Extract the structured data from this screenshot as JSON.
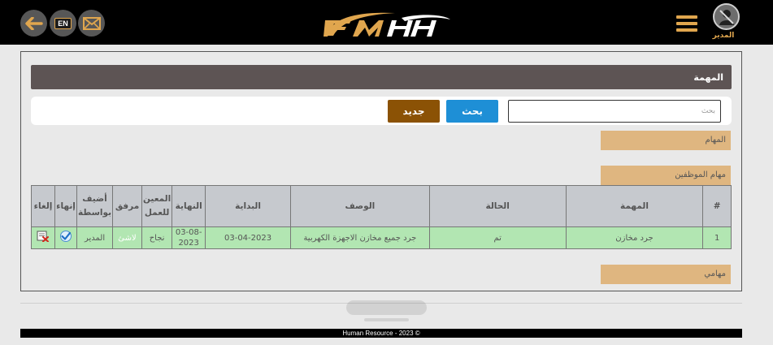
{
  "header": {
    "lang_label": "EN",
    "user_name": "المدير",
    "brand_accent": "#e0a64e",
    "icons": [
      "arrow-left-icon",
      "language-icon",
      "mail-icon",
      "hamburger-menu-icon",
      "user-avatar-icon"
    ]
  },
  "page": {
    "title": "المهمة",
    "search_placeholder": "بحث",
    "search_button": "بحث",
    "new_button": "جديد",
    "sections": {
      "tasks": "المهام",
      "employee_tasks": "مهام الموظفين",
      "my_tasks": "مهامي"
    }
  },
  "table": {
    "headers": {
      "index": "#",
      "task": "المهمة",
      "status": "الحالة",
      "description": "الوصف",
      "start": "البداية",
      "end": "النهاية",
      "assignee": "المعين للعمل",
      "attachment": "مرفق",
      "added_by": "أضيف بواسطة",
      "finish": "إنهاء",
      "cancel": "إلغاء"
    },
    "rows": [
      {
        "index": "1",
        "task": "جرد مخازن",
        "status": "تم",
        "description": "جرد جميع مخازن الاجهزة الكهربية",
        "start": "03-04-2023",
        "end": "03-08-2023",
        "assignee": "نجاح",
        "attachment": "لاشئ",
        "added_by": "المدير"
      }
    ]
  },
  "footer": {
    "text": "Human Resource - 2023 ©"
  }
}
